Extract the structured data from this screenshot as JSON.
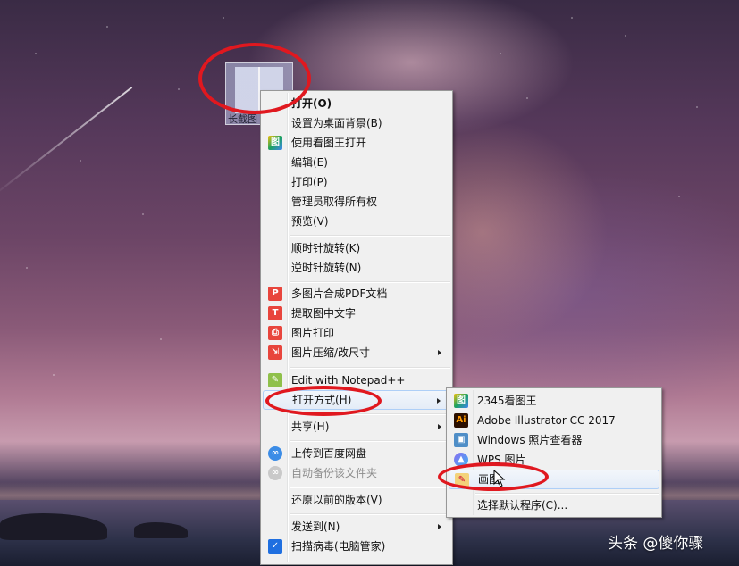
{
  "desktop": {
    "file_caption": "长截图"
  },
  "context_menu": {
    "items": [
      {
        "label": "打开(O)",
        "bold": true
      },
      {
        "label": "设置为桌面背景(B)"
      },
      {
        "label": "使用看图王打开",
        "icon": "kantuwang-icon"
      },
      {
        "label": "编辑(E)"
      },
      {
        "label": "打印(P)"
      },
      {
        "label": "管理员取得所有权"
      },
      {
        "label": "预览(V)"
      },
      {
        "label": "顺时针旋转(K)"
      },
      {
        "label": "逆时针旋转(N)"
      },
      {
        "label": "多图片合成PDF文档",
        "icon": "pdf-merge-icon"
      },
      {
        "label": "提取图中文字",
        "icon": "text-extract-icon"
      },
      {
        "label": "图片打印",
        "icon": "printer-icon"
      },
      {
        "label": "图片压缩/改尺寸",
        "icon": "compress-icon",
        "submenu": true
      },
      {
        "label": "Edit with Notepad++",
        "icon": "notepad-plus-plus-icon"
      },
      {
        "label": "打开方式(H)",
        "submenu": true,
        "highlighted": true
      },
      {
        "label": "共享(H)",
        "submenu": true
      },
      {
        "label": "上传到百度网盘",
        "icon": "baidu-netdisk-icon"
      },
      {
        "label": "自动备份该文件夹",
        "icon": "baidu-backup-icon",
        "disabled": true
      },
      {
        "label": "还原以前的版本(V)"
      },
      {
        "label": "发送到(N)",
        "submenu": true
      },
      {
        "label": "扫描病毒(电脑管家)",
        "icon": "shield-icon"
      }
    ]
  },
  "open_with_submenu": {
    "items": [
      {
        "label": "2345看图王",
        "icon": "kantuwang-icon"
      },
      {
        "label": "Adobe Illustrator CC 2017",
        "icon": "illustrator-icon"
      },
      {
        "label": "Windows 照片查看器",
        "icon": "photo-viewer-icon"
      },
      {
        "label": "WPS 图片",
        "icon": "wps-picture-icon"
      },
      {
        "label": "画图",
        "icon": "paint-icon",
        "highlighted": true
      },
      {
        "label": "选择默认程序(C)..."
      }
    ]
  },
  "watermark": "头条 @傻你骤",
  "colors": {
    "annotation_red": "#e0181f",
    "menu_bg": "#f0f0f0",
    "highlight_border": "#aecff7"
  }
}
